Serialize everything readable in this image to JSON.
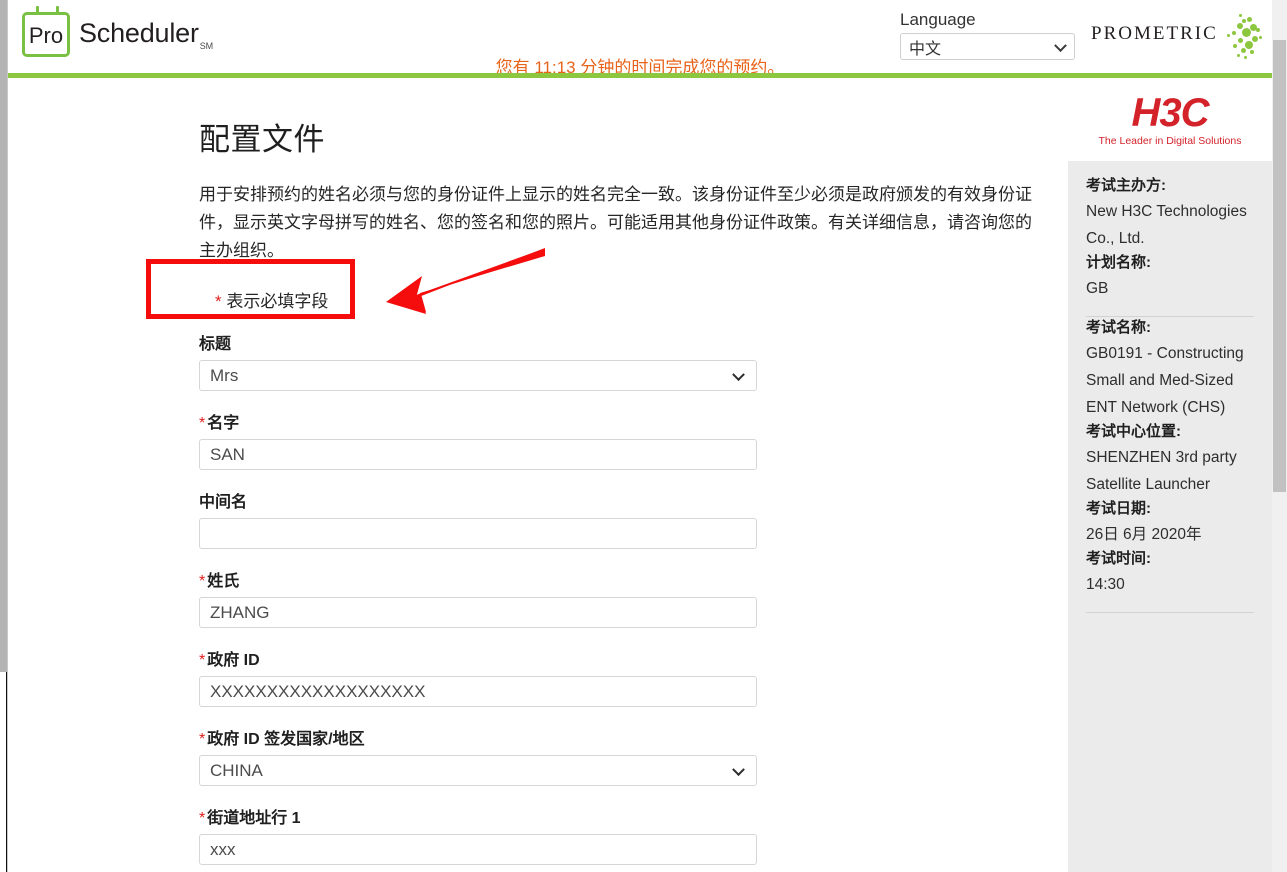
{
  "header": {
    "brand_pro": "Pro",
    "brand_scheduler": "Scheduler",
    "brand_sm": "SM",
    "language_label": "Language",
    "language_value": "中文",
    "prometric_wordmark": "PROMETRIC",
    "timer_text": "您有 11:13 分钟的时间完成您的预约。",
    "accent_green": "#8dc63f",
    "timer_color": "#e8631a"
  },
  "main": {
    "page_title": "配置文件",
    "intro": "用于安排预约的姓名必须与您的身份证件上显示的姓名完全一致。该身份证件至少必须是政府颁发的有效身份证件，显示英文字母拼写的姓名、您的签名和您的照片。可能适用其他身份证件政策。有关详细信息，请咨询您的主办组织。",
    "required_note_star": "*",
    "required_note_text": "表示必填字段",
    "required_star_color": "#e02020",
    "annotation_color": "#f50d0d",
    "fields": [
      {
        "name": "title",
        "label": "标题",
        "required": false,
        "type": "select",
        "value": "Mrs",
        "placeholder": ""
      },
      {
        "name": "first-name",
        "label": "名字",
        "required": true,
        "type": "text",
        "value": "SAN",
        "placeholder": ""
      },
      {
        "name": "middle-name",
        "label": "中间名",
        "required": false,
        "type": "text",
        "value": "",
        "placeholder": ""
      },
      {
        "name": "last-name",
        "label": "姓氏",
        "required": true,
        "type": "text",
        "value": "ZHANG",
        "placeholder": ""
      },
      {
        "name": "government-id",
        "label": "政府 ID",
        "required": true,
        "type": "text",
        "value": "XXXXXXXXXXXXXXXXXXX",
        "placeholder": ""
      },
      {
        "name": "government-id-country",
        "label": "政府 ID 签发国家/地区",
        "required": true,
        "type": "select",
        "value": "CHINA",
        "placeholder": ""
      },
      {
        "name": "street-address-1",
        "label": "街道地址行 1",
        "required": true,
        "type": "text",
        "value": "xxx",
        "placeholder": ""
      }
    ]
  },
  "sidebar": {
    "logo_word": "H3C",
    "logo_tagline": "The Leader in Digital Solutions",
    "logo_color": "#d3222a",
    "items": [
      {
        "key": "考试主办方:",
        "value": "New H3C Technologies Co., Ltd.",
        "divider_after": false
      },
      {
        "key": "计划名称:",
        "value": "GB",
        "divider_after": true
      },
      {
        "key": "考试名称:",
        "value": "GB0191 - Constructing Small and Med-Sized ENT Network (CHS)",
        "divider_after": false
      },
      {
        "key": "考试中心位置:",
        "value": "SHENZHEN 3rd party Satellite Launcher",
        "divider_after": false
      },
      {
        "key": "考试日期:",
        "value": "26日 6月 2020年",
        "divider_after": false
      },
      {
        "key": "考试时间:",
        "value": "14:30",
        "divider_after": true
      }
    ]
  }
}
